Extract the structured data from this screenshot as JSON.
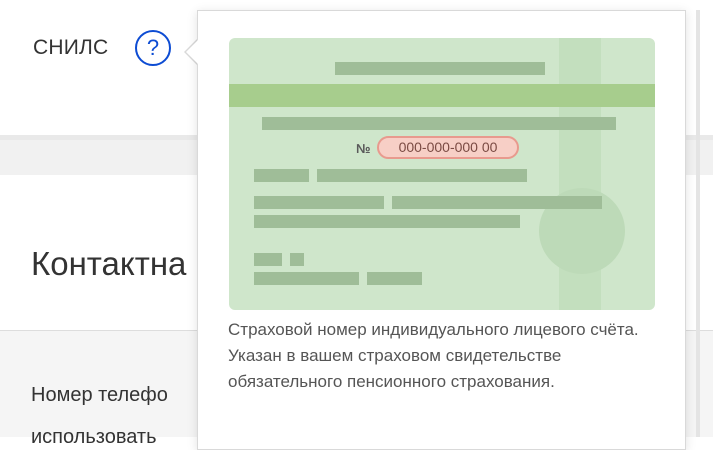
{
  "snils": {
    "label": "СНИЛС",
    "help_icon": "?"
  },
  "contacts": {
    "title": "Контактна",
    "phone_text": "Номер телефо",
    "cut_line": "использовать"
  },
  "popover": {
    "card_number_prefix": "№",
    "card_number": "000-000-000 00",
    "description": "Страховой номер индивидуального лицевого счёта. Указан в вашем страховом свидетельстве обязательного пенсионного страхования."
  },
  "colors": {
    "accent": "#0d4cd3",
    "card_green": "#cfe6cb",
    "card_band": "#a7cd8d",
    "pill_fill": "#f7cfc6",
    "pill_border": "#e89a8e"
  }
}
